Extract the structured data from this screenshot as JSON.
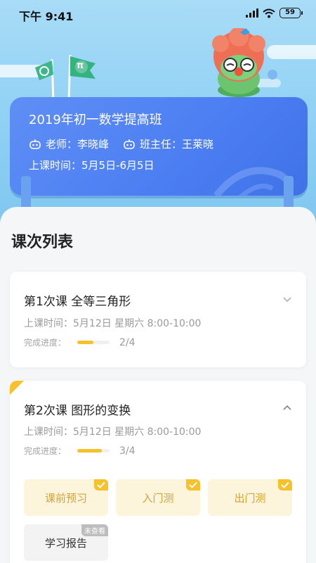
{
  "status_bar": {
    "time": "下午 9:41",
    "battery": "59"
  },
  "banner": {
    "title": "2019年初一数学提高班",
    "teacher": "老师：李晓峰",
    "head_teacher": "班主任：王莱晓",
    "schedule": "上课时间：5月5日-6月5日",
    "flag_symbol": "π"
  },
  "section_title": "课次列表",
  "lessons": [
    {
      "title": "第1次课  全等三角形",
      "time": "上课时间：5月12日 星期六 8:00-10:00",
      "progress_label": "完成进度：",
      "progress_value": 0.5,
      "progress_text": "2/4",
      "expanded": false
    },
    {
      "title": "第2次课  图形的变换",
      "time": "上课时间：5月12日 星期六 8:00-10:00",
      "progress_label": "完成进度：",
      "progress_value": 0.75,
      "progress_text": "3/4",
      "expanded": true,
      "tasks": [
        {
          "label": "课前预习",
          "done": true
        },
        {
          "label": "入门测",
          "done": true
        },
        {
          "label": "出门测",
          "done": true
        },
        {
          "label": "学习报告",
          "badge": "未查看"
        }
      ]
    }
  ],
  "colors": {
    "accent": "#f6c12b",
    "banner": "#4b7ef2",
    "sky": "#8fd0f4"
  }
}
